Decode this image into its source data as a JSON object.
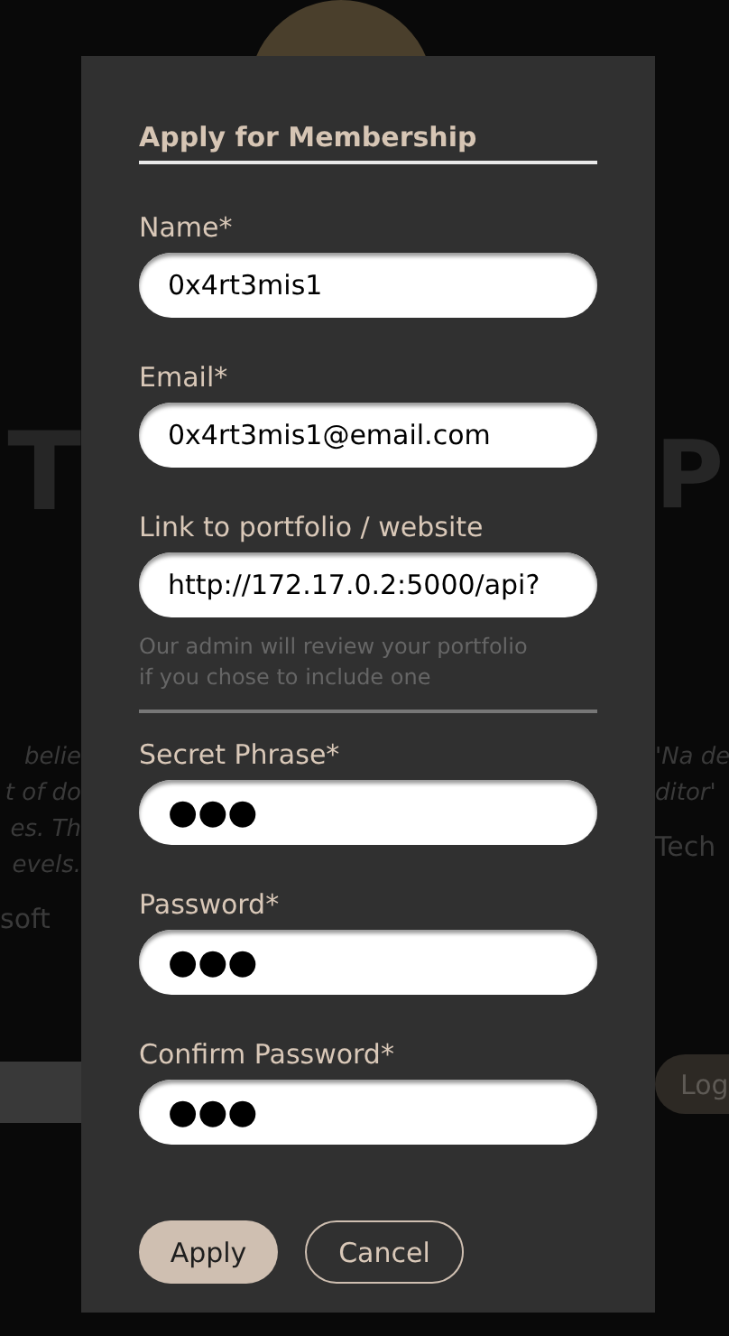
{
  "background": {
    "left": {
      "heading": "T",
      "quote_lines": [
        "belie",
        "t of do",
        "es. Th",
        "evels."
      ],
      "author": "soft"
    },
    "right": {
      "heading": "P",
      "quote_lines": [
        "'Na de",
        "ditor'"
      ],
      "author": "Tech",
      "button": "Log"
    }
  },
  "modal": {
    "title": "Apply for Membership",
    "fields": [
      {
        "label": "Name*",
        "value": "0x4rt3mis1",
        "kind": "text"
      },
      {
        "label": "Email*",
        "value": "0x4rt3mis1@email.com",
        "kind": "text"
      },
      {
        "label": "Link to portfolio / website",
        "value": "http://172.17.0.2:5000/api?",
        "kind": "text",
        "hint": "Our admin will review your portfolio if you chose to include one"
      },
      {
        "label": "Secret Phrase*",
        "value": "●●●",
        "kind": "password"
      },
      {
        "label": "Password*",
        "value": "●●●",
        "kind": "password"
      },
      {
        "label": "Confirm Password*",
        "value": "●●●",
        "kind": "password"
      }
    ],
    "buttons": [
      {
        "label": "Apply",
        "kind": "primary"
      },
      {
        "label": "Cancel",
        "kind": "secondary"
      }
    ]
  }
}
